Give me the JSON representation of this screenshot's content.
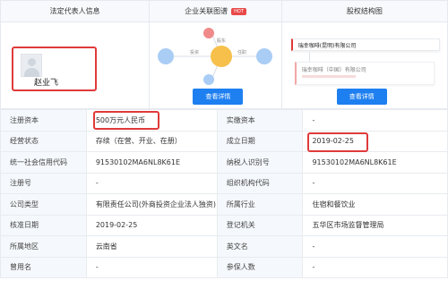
{
  "header": {
    "legal_rep_title": "法定代表人信息",
    "graph_title": "企业关联图谱",
    "hot_badge": "HOT",
    "equity_title": "股权结构图"
  },
  "legal_rep": {
    "name": "赵业飞"
  },
  "graph": {
    "left_label": "投资",
    "top_label": "股东",
    "right_label": "任职",
    "button": "查看详情"
  },
  "equity": {
    "company_main": "瑞幸咖啡(昆明)有限公司",
    "company_sub": "瑞幸咖啡（中国）有限公司",
    "button": "查看详情"
  },
  "table": {
    "rows": [
      {
        "l1": "注册资本",
        "v1": "500万元人民币",
        "l2": "实缴资本",
        "v2": "-"
      },
      {
        "l1": "经营状态",
        "v1": "存续（在营、开业、在册）",
        "l2": "成立日期",
        "v2": "2019-02-25"
      },
      {
        "l1": "统一社会信用代码",
        "v1": "91530102MA6NL8K61E",
        "l2": "纳税人识别号",
        "v2": "91530102MA6NL8K61E"
      },
      {
        "l1": "注册号",
        "v1": "-",
        "l2": "组织机构代码",
        "v2": "-"
      },
      {
        "l1": "公司类型",
        "v1": "有限责任公司(外商投资企业法人独资)",
        "l2": "所属行业",
        "v2": "住宿和餐饮业"
      },
      {
        "l1": "核准日期",
        "v1": "2019-02-25",
        "l2": "登记机关",
        "v2": "五华区市场监督管理局"
      },
      {
        "l1": "所属地区",
        "v1": "云南省",
        "l2": "英文名",
        "v2": "-"
      },
      {
        "l1": "曾用名",
        "v1": "-",
        "l2": "参保人数",
        "v2": "-"
      }
    ]
  },
  "colors": {
    "accent_blue": "#1e7ff0",
    "highlight_red": "#e03a3a",
    "label_bg": "#f5f8fc",
    "node_orange": "#f6c04a",
    "node_red": "#f08a8a",
    "node_blue": "#a9cdf5"
  }
}
